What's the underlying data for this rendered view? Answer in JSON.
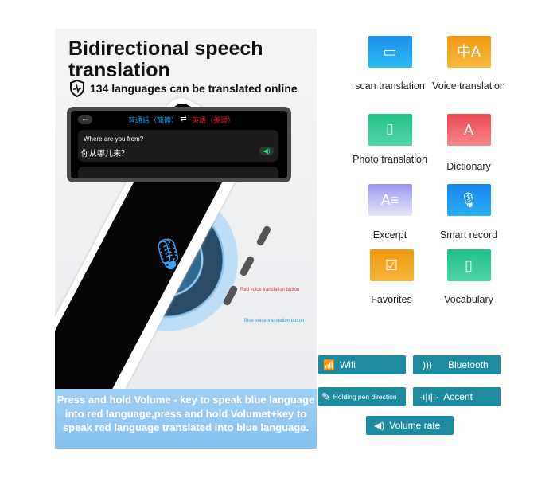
{
  "left_panel": {
    "title": "Bidirectional speech translation",
    "subtitle": "134 languages can be translated online",
    "screen": {
      "source_lang": "普通話（簡體）",
      "swap": "⇄",
      "target_lang": "英語（美國）",
      "question": "Where are you from?",
      "answer": "你从哪儿来？"
    },
    "red_note": "Red voice translation button",
    "blue_note": "Blue voice translation button",
    "banner": "Press and hold Volume - key to speak blue language into red language,press and hold Volumet+key to speak red language translated into blue language."
  },
  "features": [
    {
      "label": "scan translation",
      "icon": "scan-icon",
      "color": "#1e9ff0"
    },
    {
      "label": "Voice translation",
      "icon": "translate-icon",
      "color": "#f2a41e"
    },
    {
      "label": "Photo translation",
      "icon": "camera-icon",
      "color": "#2fc894"
    },
    {
      "label": "Dictionary",
      "icon": "dictionary-icon",
      "color": "#ee5b5f"
    },
    {
      "label": "Excerpt",
      "icon": "excerpt-icon",
      "color": "#a9a6f2"
    },
    {
      "label": "Smart record",
      "icon": "microphone-icon",
      "color": "#1a9af0"
    },
    {
      "label": "Favorites",
      "icon": "favorites-icon",
      "color": "#f3a11a"
    },
    {
      "label": "Vocabulary",
      "icon": "notebook-icon",
      "color": "#2ec892"
    }
  ],
  "specs": [
    {
      "label": "Wifi",
      "icon": "wifi-icon"
    },
    {
      "label": "Bluetooth",
      "icon": "bluetooth-icon"
    },
    {
      "label": "Holding pen direction",
      "icon": "edit-icon"
    },
    {
      "label": "Accent",
      "icon": "waveform-icon"
    },
    {
      "label": "Volume rate",
      "icon": "speaker-icon"
    }
  ],
  "colors": {
    "spec_bg": "#1e8aa0",
    "banner": "#93c9f3",
    "blue_lang": "#1aa0e8",
    "red_lang": "#e02020"
  }
}
